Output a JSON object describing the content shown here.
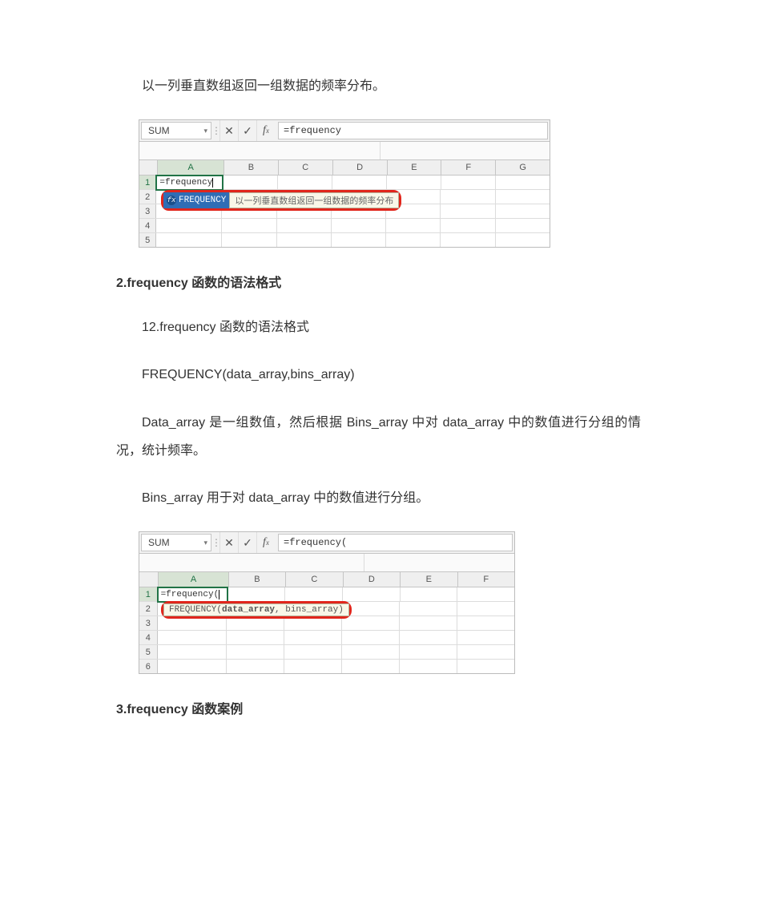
{
  "intro_text": "以一列垂直数组返回一组数据的频率分布。",
  "heading2": "2.frequency 函数的语法格式",
  "syntax_line": "12.frequency 函数的语法格式",
  "syntax_formula": "FREQUENCY(data_array,bins_array)",
  "explain1": "Data_array 是一组数值，然后根据 Bins_array 中对 data_array 中的数值进行分组的情况，统计频率。",
  "explain2": "Bins_array 用于对 data_array 中的数值进行分组。",
  "heading3": "3.frequency 函数案例",
  "excel1": {
    "namebox": "SUM",
    "formula": "=frequency",
    "cols": [
      "A",
      "B",
      "C",
      "D",
      "E",
      "F",
      "G"
    ],
    "rows": [
      "1",
      "2",
      "3",
      "4",
      "5"
    ],
    "cellA1": "=frequency",
    "tooltip_fn": "FREQUENCY",
    "tooltip_desc": "以一列垂直数组返回一组数据的频率分布"
  },
  "excel2": {
    "namebox": "SUM",
    "formula": "=frequency(",
    "cols": [
      "A",
      "B",
      "C",
      "D",
      "E",
      "F"
    ],
    "rows": [
      "1",
      "2",
      "3",
      "4",
      "5",
      "6"
    ],
    "cellA1": "=frequency(",
    "tooltip_fn": "FREQUENCY(",
    "tooltip_arg1": "data_array",
    "tooltip_rest": ", bins_array)"
  }
}
